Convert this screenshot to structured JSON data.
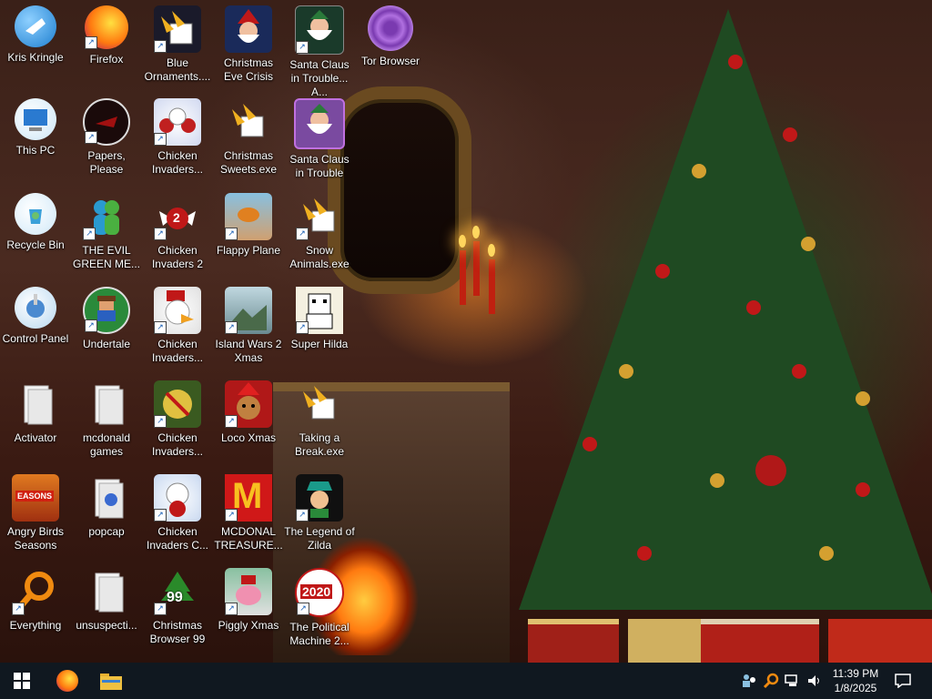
{
  "desktop": {
    "icons": [
      {
        "label": "Kris Kringle"
      },
      {
        "label": "Firefox"
      },
      {
        "label": "Blue Ornaments...."
      },
      {
        "label": "Christmas Eve Crisis"
      },
      {
        "label": "Santa Claus in Trouble... A..."
      },
      {
        "label": "Tor Browser"
      },
      {
        "label": "This PC"
      },
      {
        "label": "Papers, Please"
      },
      {
        "label": "Chicken Invaders..."
      },
      {
        "label": "Christmas Sweets.exe"
      },
      {
        "label": "Santa Claus in Trouble"
      },
      {
        "label": "Recycle Bin"
      },
      {
        "label": "THE EVIL GREEN ME..."
      },
      {
        "label": "Chicken Invaders 2"
      },
      {
        "label": "Flappy Plane"
      },
      {
        "label": "Snow Animals.exe"
      },
      {
        "label": "Control Panel"
      },
      {
        "label": "Undertale"
      },
      {
        "label": "Chicken Invaders..."
      },
      {
        "label": "Island Wars 2 Xmas"
      },
      {
        "label": "Super Hilda"
      },
      {
        "label": "Activator"
      },
      {
        "label": "mcdonald games"
      },
      {
        "label": "Chicken Invaders..."
      },
      {
        "label": "Loco Xmas"
      },
      {
        "label": "Taking a Break.exe"
      },
      {
        "label": "Angry Birds Seasons"
      },
      {
        "label": "popcap"
      },
      {
        "label": "Chicken Invaders C..."
      },
      {
        "label": "MCDONAL TREASURE..."
      },
      {
        "label": "The Legend of Zilda"
      },
      {
        "label": "Everything"
      },
      {
        "label": "unsuspecti..."
      },
      {
        "label": "Christmas Browser 99"
      },
      {
        "label": "Piggly Xmas"
      },
      {
        "label": "The Political Machine 2..."
      }
    ],
    "badges": {
      "chicken2": "2",
      "browser99": "99",
      "political": "2020",
      "angry": "EASONS",
      "mcd": "M"
    }
  },
  "taskbar": {
    "clock_time": "11:39 PM",
    "clock_date": "1/8/2025"
  },
  "colors": {
    "taskbar": "#101820",
    "accent": "#1a5fb4"
  }
}
